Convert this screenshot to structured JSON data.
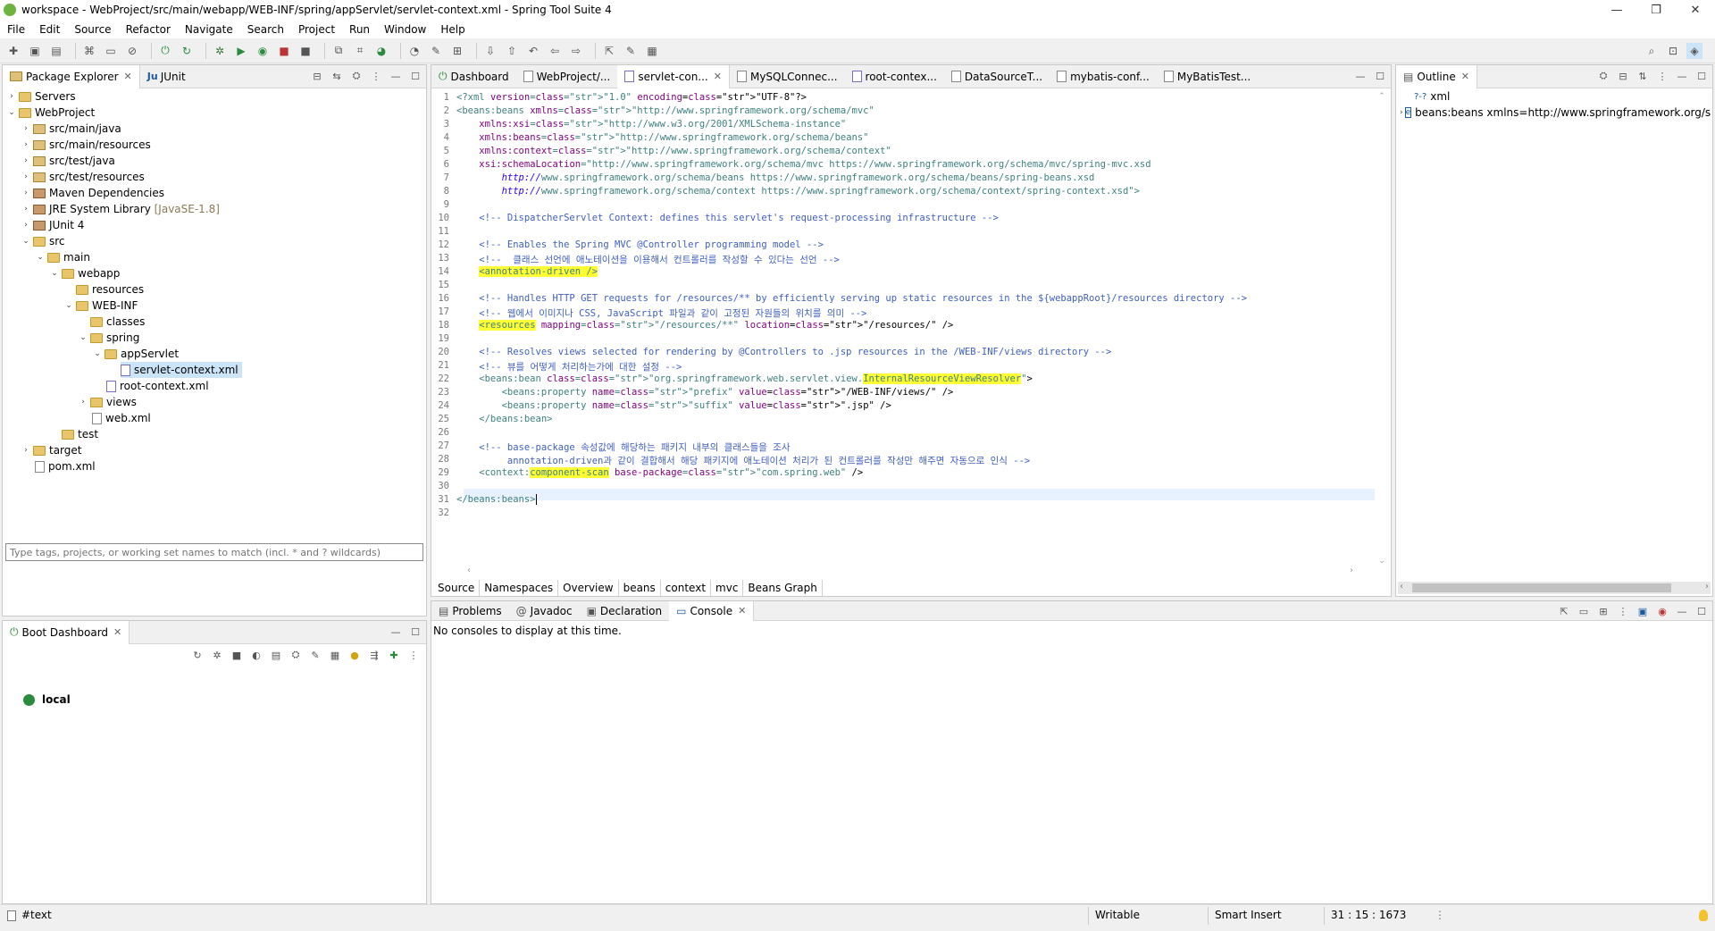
{
  "window": {
    "title": "workspace - WebProject/src/main/webapp/WEB-INF/spring/appServlet/servlet-context.xml - Spring Tool Suite 4",
    "minimize": "—",
    "restore": "❐",
    "close": "✕"
  },
  "menu": [
    "File",
    "Edit",
    "Source",
    "Refactor",
    "Navigate",
    "Search",
    "Project",
    "Run",
    "Window",
    "Help"
  ],
  "package_explorer": {
    "tabs": [
      {
        "label": "Package Explorer"
      },
      {
        "label": "JUnit"
      }
    ],
    "items": [
      {
        "label": "Servers",
        "decor": ""
      },
      {
        "label": "WebProject",
        "decor": ""
      },
      {
        "label": "src/main/java",
        "decor": ""
      },
      {
        "label": "src/main/resources",
        "decor": ""
      },
      {
        "label": "src/test/java",
        "decor": ""
      },
      {
        "label": "src/test/resources",
        "decor": ""
      },
      {
        "label": "Maven Dependencies",
        "decor": ""
      },
      {
        "label": "JRE System Library",
        "decor": "[JavaSE-1.8]"
      },
      {
        "label": "JUnit 4",
        "decor": ""
      },
      {
        "label": "src",
        "decor": ""
      },
      {
        "label": "main",
        "decor": ""
      },
      {
        "label": "webapp",
        "decor": ""
      },
      {
        "label": "resources",
        "decor": ""
      },
      {
        "label": "WEB-INF",
        "decor": ""
      },
      {
        "label": "classes",
        "decor": ""
      },
      {
        "label": "spring",
        "decor": ""
      },
      {
        "label": "appServlet",
        "decor": ""
      },
      {
        "label": "servlet-context.xml",
        "decor": ""
      },
      {
        "label": "root-context.xml",
        "decor": ""
      },
      {
        "label": "views",
        "decor": ""
      },
      {
        "label": "web.xml",
        "decor": ""
      },
      {
        "label": "test",
        "decor": ""
      },
      {
        "label": "target",
        "decor": ""
      },
      {
        "label": "pom.xml",
        "decor": ""
      }
    ]
  },
  "editor": {
    "tabs": [
      "Dashboard",
      "WebProject/...",
      "servlet-con...",
      "MySQLConnec...",
      "root-contex...",
      "DataSourceT...",
      "mybatis-conf...",
      "MyBatisTest..."
    ],
    "active_tab": "servlet-con...",
    "bottom_tabs": [
      "Source",
      "Namespaces",
      "Overview",
      "beans",
      "context",
      "mvc",
      "Beans Graph"
    ],
    "lines": [
      {
        "n": "1",
        "text": "<?xml version=\"1.0\" encoding=\"UTF-8\"?>"
      },
      {
        "n": "2",
        "text": "<beans:beans xmlns=\"http://www.springframework.org/schema/mvc\""
      },
      {
        "n": "3",
        "text": "    xmlns:xsi=\"http://www.w3.org/2001/XMLSchema-instance\""
      },
      {
        "n": "4",
        "text": "    xmlns:beans=\"http://www.springframework.org/schema/beans\""
      },
      {
        "n": "5",
        "text": "    xmlns:context=\"http://www.springframework.org/schema/context\""
      },
      {
        "n": "6",
        "text": "    xsi:schemaLocation=\"http://www.springframework.org/schema/mvc https://www.springframework.org/schema/mvc/spring-mvc.xsd"
      },
      {
        "n": "7",
        "text": "        http://www.springframework.org/schema/beans https://www.springframework.org/schema/beans/spring-beans.xsd"
      },
      {
        "n": "8",
        "text": "        http://www.springframework.org/schema/context https://www.springframework.org/schema/context/spring-context.xsd\">"
      },
      {
        "n": "9",
        "text": ""
      },
      {
        "n": "10",
        "text": "    <!-- DispatcherServlet Context: defines this servlet's request-processing infrastructure -->"
      },
      {
        "n": "11",
        "text": ""
      },
      {
        "n": "12",
        "text": "    <!-- Enables the Spring MVC @Controller programming model -->"
      },
      {
        "n": "13",
        "text": "    <!--  클래스 선언에 애노테이션을 이용해서 컨트롤러를 작성할 수 있다는 선언 -->"
      },
      {
        "n": "14",
        "text": "    <annotation-driven />"
      },
      {
        "n": "15",
        "text": ""
      },
      {
        "n": "16",
        "text": "    <!-- Handles HTTP GET requests for /resources/** by efficiently serving up static resources in the ${webappRoot}/resources directory -->"
      },
      {
        "n": "17",
        "text": "    <!-- 웹에서 이미지나 CSS, JavaScript 파일과 같이 고정된 자원들의 위치를 의미 -->"
      },
      {
        "n": "18",
        "text": "    <resources mapping=\"/resources/**\" location=\"/resources/\" />"
      },
      {
        "n": "19",
        "text": ""
      },
      {
        "n": "20",
        "text": "    <!-- Resolves views selected for rendering by @Controllers to .jsp resources in the /WEB-INF/views directory -->"
      },
      {
        "n": "21",
        "text": "    <!-- 뷰를 어떻게 처리하는가에 대한 설정 -->"
      },
      {
        "n": "22",
        "text": "    <beans:bean class=\"org.springframework.web.servlet.view.InternalResourceViewResolver\">"
      },
      {
        "n": "23",
        "text": "        <beans:property name=\"prefix\" value=\"/WEB-INF/views/\" />"
      },
      {
        "n": "24",
        "text": "        <beans:property name=\"suffix\" value=\".jsp\" />"
      },
      {
        "n": "25",
        "text": "    </beans:bean>"
      },
      {
        "n": "26",
        "text": ""
      },
      {
        "n": "27",
        "text": "    <!-- base-package 속성값에 해당하는 패키지 내부의 클래스들을 조사"
      },
      {
        "n": "28",
        "text": "         annotation-driven과 같이 결합해서 해당 패키지에 애노테이션 처리가 된 컨트롤러를 작성만 해주면 자동으로 인식 -->"
      },
      {
        "n": "29",
        "text": "    <context:component-scan base-package=\"com.spring.web\" />"
      },
      {
        "n": "30",
        "text": ""
      },
      {
        "n": "31",
        "text": "</beans:beans>"
      },
      {
        "n": "32",
        "text": ""
      }
    ]
  },
  "outline": {
    "tab": "Outline",
    "items": [
      {
        "label": "xml"
      },
      {
        "label": "beans:beans xmlns=http://www.springframework.org/schema"
      }
    ]
  },
  "boot_dashboard": {
    "tab": "Boot Dashboard",
    "filter_placeholder": "Type tags, projects, or working set names to match (incl. * and ? wildcards)",
    "items": [
      {
        "label": "local"
      }
    ]
  },
  "console_area": {
    "tabs": [
      "Problems",
      "Javadoc",
      "Declaration",
      "Console"
    ],
    "active_tab": "Console",
    "message": "No consoles to display at this time."
  },
  "status": {
    "selection": "#text",
    "writable": "Writable",
    "insert_mode": "Smart Insert",
    "position": "31 : 15 : 1673"
  },
  "colors": {
    "selection": "#cce4f7",
    "highlight": "#ffff33",
    "comment": "#3f5fbf",
    "tag": "#3f7f7f",
    "attribute": "#7f007f",
    "string": "#2a00ff"
  }
}
